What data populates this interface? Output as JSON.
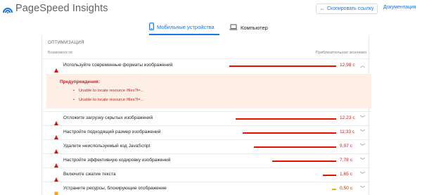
{
  "header": {
    "app_title": "PageSpeed Insights",
    "copy_link_label": "Скопировать ссылку",
    "docs_label": "Документация"
  },
  "tabs": [
    {
      "label": "Мобильные устройства",
      "active": true,
      "icon": "phone-icon"
    },
    {
      "label": "Компьютер",
      "active": false,
      "icon": "laptop-icon"
    }
  ],
  "section": {
    "title": "ОПТИМИЗАЦИЯ",
    "col_left": "Возможности",
    "col_right": "Приблизительная экономия"
  },
  "opportunities": [
    {
      "label": "Используйте современные форматы изображений",
      "value": "12,98 с",
      "savings_seconds": 12.98,
      "status": "fail",
      "expanded": true
    },
    {
      "label": "Отложите загрузку скрытых изображений",
      "value": "12,23 с",
      "savings_seconds": 12.23,
      "status": "fail"
    },
    {
      "label": "Настройте подходящий размер изображений",
      "value": "11,33 с",
      "savings_seconds": 11.33,
      "status": "fail"
    },
    {
      "label": "Удалите неиспользуемый код JavaScript",
      "value": "9,97 с",
      "savings_seconds": 9.97,
      "status": "fail"
    },
    {
      "label": "Настройте эффективную кодировку изображений",
      "value": "7,78 с",
      "savings_seconds": 7.78,
      "status": "fail"
    },
    {
      "label": "Включите сжатие текста",
      "value": "1,65 с",
      "savings_seconds": 1.65,
      "status": "fail"
    },
    {
      "label": "Устраните ресурсы, блокирующие отображение",
      "value": "0,50 с",
      "savings_seconds": 0.5,
      "status": "average"
    }
  ],
  "warnings": {
    "title": "Предупреждения:",
    "items": [
      "Unable to locate resource /files?l=...",
      "Unable to locate resource /files?l=..."
    ]
  },
  "colors": {
    "fail": "#eb0f00",
    "average": "#ffa400",
    "accent": "#1a73e8",
    "warning_bg": "#fdefe6"
  }
}
